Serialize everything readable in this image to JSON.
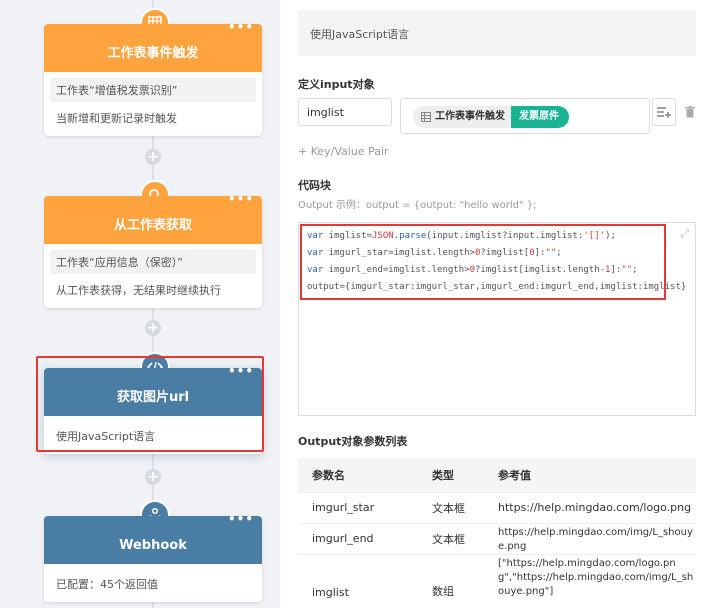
{
  "flow": {
    "nodes": [
      {
        "title": "工作表事件触发",
        "sub": "工作表“增值税发票识别”",
        "desc": "当新增和更新记录时触发",
        "icon": "table-icon",
        "color": "#ffa33e"
      },
      {
        "title": "从工作表获取",
        "sub": "工作表“应用信息（保密）”",
        "desc": "从工作表获得，无结果时继续执行",
        "icon": "search-icon",
        "color": "#ffa33e"
      },
      {
        "title": "获取图片url",
        "desc": "使用JavaScript语言",
        "icon": "code-icon",
        "color": "#4a7da4"
      },
      {
        "title": "Webhook",
        "desc": "已配置：45个返回值",
        "icon": "webhook-icon",
        "color": "#4a7da4"
      }
    ],
    "more": "•••"
  },
  "panel": {
    "language": "使用JavaScript语言",
    "input_title": "定义input对象",
    "input_key": "imglist",
    "chip_source": "工作表事件触发",
    "chip_field": "发票原件",
    "add_pair": "+ Key/Value Pair",
    "code_title": "代码块",
    "code_hint": "Output 示例：output = {output: \"hello world\" };",
    "code_lines": [
      "var imglist=JSON.parse(input.imglist?input.imglist:'[]');",
      "var imgurl_star=imglist.length>0?imglist[0]:\"\";",
      "var imgurl_end=imglist.length>0?imglist[imglist.length-1]:\"\";",
      "output={imgurl_star:imgurl_star,imgurl_end:imgurl_end,imglist:imglist}"
    ],
    "output_title": "Output对象参数列表",
    "table": {
      "headers": [
        "参数名",
        "类型",
        "参考值"
      ],
      "rows": [
        [
          "imgurl_star",
          "文本框",
          "https://help.mingdao.com/logo.png"
        ],
        [
          "imgurl_end",
          "文本框",
          "https://help.mingdao.com/img/L_shouye.png"
        ],
        [
          "imglist",
          "数组",
          "[\"https://help.mingdao.com/logo.png\",\"https://help.mingdao.com/img/L_shouye.png\"]"
        ]
      ]
    }
  },
  "colors": {
    "accent_orange": "#ffa33e",
    "accent_steel": "#4a7da4",
    "highlight_red": "#e53935",
    "chip_green": "#1ab394"
  }
}
